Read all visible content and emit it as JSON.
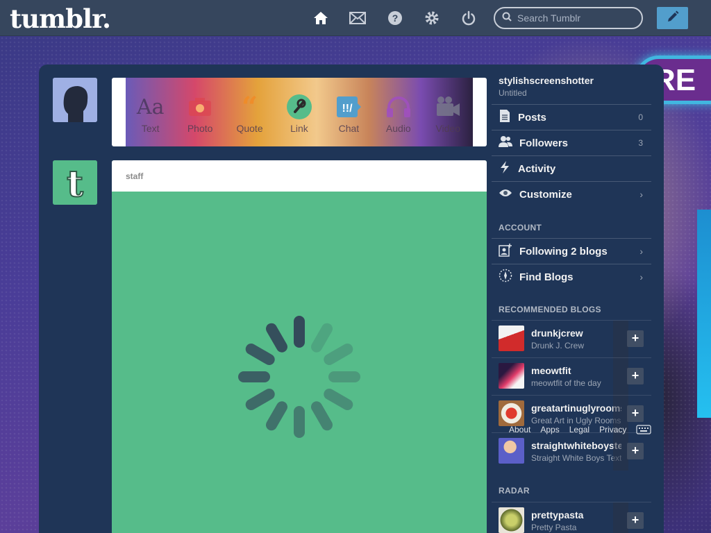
{
  "header": {
    "logo": "tumblr.",
    "search_placeholder": "Search Tumblr",
    "nav": [
      {
        "name": "home-icon"
      },
      {
        "name": "mail-icon"
      },
      {
        "name": "help-icon"
      },
      {
        "name": "gear-icon"
      },
      {
        "name": "power-icon"
      }
    ],
    "compose_icon": "pencil-icon"
  },
  "post_types": [
    {
      "label": "Text",
      "icon": "text-icon"
    },
    {
      "label": "Photo",
      "icon": "camera-icon"
    },
    {
      "label": "Quote",
      "icon": "quote-icon"
    },
    {
      "label": "Link",
      "icon": "link-icon"
    },
    {
      "label": "Chat",
      "icon": "chat-icon"
    },
    {
      "label": "Audio",
      "icon": "headphones-icon"
    },
    {
      "label": "Video",
      "icon": "video-icon"
    }
  ],
  "post": {
    "author": "staff"
  },
  "sidebar": {
    "blog_name": "stylishscreenshotter",
    "blog_title": "Untitled",
    "items": [
      {
        "label": "Posts",
        "count": "0"
      },
      {
        "label": "Followers",
        "count": "3"
      },
      {
        "label": "Activity",
        "count": ""
      },
      {
        "label": "Customize",
        "count": "›"
      }
    ],
    "account_heading": "ACCOUNT",
    "account_items": [
      {
        "label": "Following 2 blogs"
      },
      {
        "label": "Find Blogs"
      }
    ],
    "recommended_heading": "RECOMMENDED BLOGS",
    "recommended": [
      {
        "name": "drunkjcrew",
        "title": "Drunk J. Crew"
      },
      {
        "name": "meowtfit",
        "title": "meowtfit of the day"
      },
      {
        "name": "greatartinuglyrooms",
        "title": "Great Art in Ugly Rooms"
      },
      {
        "name": "straightwhiteboystexting",
        "title": "Straight White Boys Texting"
      }
    ],
    "radar_heading": "RADAR",
    "radar": [
      {
        "name": "prettypasta",
        "title": "Pretty Pasta"
      }
    ]
  },
  "footer": {
    "links": [
      "About",
      "Apps",
      "Legal",
      "Privacy"
    ]
  },
  "colors": {
    "topbar": "#36465d",
    "dashboard": "#1f3557",
    "post_green": "#56bc8a",
    "compose_blue": "#529ecc"
  }
}
